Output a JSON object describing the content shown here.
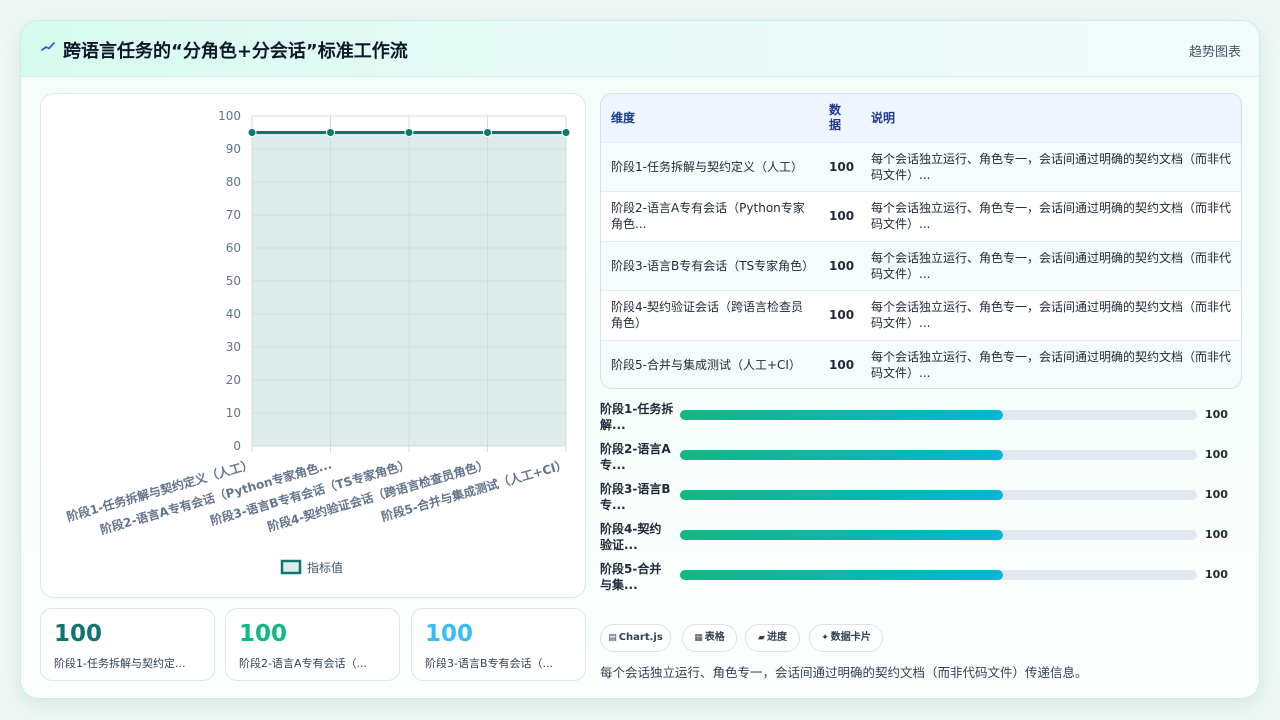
{
  "header": {
    "title": "跨语言任务的“分角色+分会话”标准工作流",
    "link": "趋势图表"
  },
  "colors": {
    "line": "#0f766e",
    "area_fill": "#dcecea",
    "stat_1": "#0f766e",
    "stat_2": "#10b981",
    "stat_3": "#38bdf8",
    "bar_from": "#10b981",
    "bar_to": "#06b6d4"
  },
  "chart_data": {
    "type": "line",
    "categories": [
      "阶段1-任务拆解与契约定义（人工）",
      "阶段2-语言A专有会话（Python专家角色...",
      "阶段3-语言B专有会话（TS专家角色）",
      "阶段4-契约验证会话（跨语言检查员角色）",
      "阶段5-合并与集成测试（人工+CI）"
    ],
    "series": [
      {
        "name": "指标值",
        "values": [
          95,
          95,
          95,
          95,
          95
        ]
      }
    ],
    "ylim": [
      0,
      100
    ],
    "yticks": [
      0,
      10,
      20,
      30,
      40,
      50,
      60,
      70,
      80,
      90,
      100
    ],
    "grid": true,
    "legend": "bottom",
    "fill": true
  },
  "stats": [
    {
      "value": "100",
      "label": "阶段1-任务拆解与契约定..."
    },
    {
      "value": "100",
      "label": "阶段2-语言A专有会话（..."
    },
    {
      "value": "100",
      "label": "阶段3-语言B专有会话（..."
    }
  ],
  "table": {
    "headers": [
      "维度",
      "数据",
      "说明"
    ],
    "rows": [
      [
        "阶段1-任务拆解与契约定义（人工）",
        "100",
        "每个会话独立运行、角色专一，会话间通过明确的契约文档（而非代码文件）..."
      ],
      [
        "阶段2-语言A专有会话（Python专家角色...",
        "100",
        "每个会话独立运行、角色专一，会话间通过明确的契约文档（而非代码文件）..."
      ],
      [
        "阶段3-语言B专有会话（TS专家角色）",
        "100",
        "每个会话独立运行、角色专一，会话间通过明确的契约文档（而非代码文件）..."
      ],
      [
        "阶段4-契约验证会话（跨语言检查员角色）",
        "100",
        "每个会话独立运行、角色专一，会话间通过明确的契约文档（而非代码文件）..."
      ],
      [
        "阶段5-合并与集成测试（人工+CI）",
        "100",
        "每个会话独立运行、角色专一，会话间通过明确的契约文档（而非代码文件）..."
      ]
    ]
  },
  "progress": [
    {
      "label": "阶段1-任务拆\n解...",
      "value": "100",
      "fraction": 0.625
    },
    {
      "label": "阶段2-语言A\n专...",
      "value": "100",
      "fraction": 0.625
    },
    {
      "label": "阶段3-语言B\n专...",
      "value": "100",
      "fraction": 0.625
    },
    {
      "label": "阶段4-契约\n验证...",
      "value": "100",
      "fraction": 0.625
    },
    {
      "label": "阶段5-合并\n与集...",
      "value": "100",
      "fraction": 0.625
    }
  ],
  "chips": [
    {
      "icon": "▤",
      "icon_name": "chart-icon",
      "label": "Chart.js"
    },
    {
      "icon": "▦",
      "icon_name": "table-icon",
      "label": "表格"
    },
    {
      "icon": "▰",
      "icon_name": "progress-icon",
      "label": "进度"
    },
    {
      "icon": "✦",
      "icon_name": "sparkle-icon",
      "label": "数据卡片"
    }
  ],
  "footer_note": "每个会话独立运行、角色专一，会话间通过明确的契约文档（而非代码文件）传递信息。"
}
